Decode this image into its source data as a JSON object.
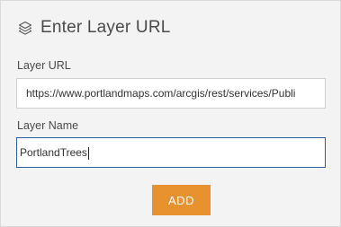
{
  "header": {
    "icon": "layers-icon",
    "title": "Enter Layer URL"
  },
  "layer_url": {
    "label": "Layer URL",
    "value": "https://www.portlandmaps.com/arcgis/rest/services/Publi"
  },
  "layer_name": {
    "label": "Layer Name",
    "value": "PortlandTrees"
  },
  "actions": {
    "add_label": "ADD"
  },
  "colors": {
    "panel_bg": "#f3f3f3",
    "add_button": "#e8912f",
    "focused_border": "#2b5fa1"
  }
}
